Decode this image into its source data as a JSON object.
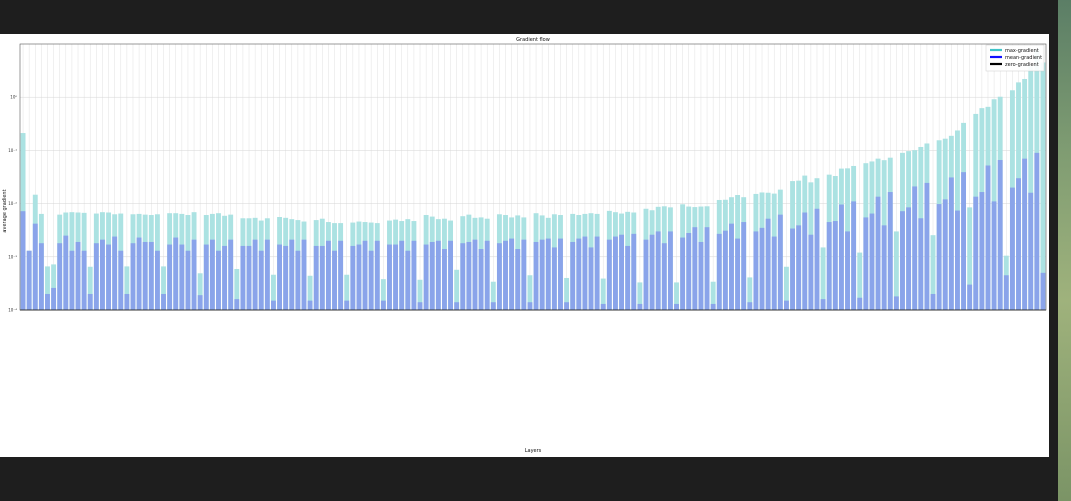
{
  "colors": {
    "max_bar": "#abe2e2",
    "mean_bar": "#8aa4ea",
    "zero_line": "#000000",
    "legend_max": "#3fc4c9",
    "legend_mean": "#1010ff",
    "grid": "#d6d6d6"
  },
  "chart_data": {
    "type": "bar",
    "title": "Gradient flow",
    "xlabel": "Layers",
    "ylabel": "average gradient",
    "y_scale": "log",
    "ylim": [
      0.0001,
      10
    ],
    "y_ticks": [
      {
        "value": 0.0001,
        "label": "10⁻⁴"
      },
      {
        "value": 0.001,
        "label": "10⁻³"
      },
      {
        "value": 0.01,
        "label": "10⁻²"
      },
      {
        "value": 0.1,
        "label": "10⁻¹"
      },
      {
        "value": 1,
        "label": "10⁰"
      }
    ],
    "grid": true,
    "legend": {
      "placement": "top-right",
      "entries": [
        "max-gradient",
        "mean-gradient",
        "zero-gradient"
      ]
    },
    "series": [
      {
        "name": "max-gradient",
        "values": [
          0.212,
          0.0013,
          0.0147,
          0.0064,
          0.00066,
          0.00072,
          0.0062,
          0.0068,
          0.0069,
          0.0068,
          0.0067,
          0.00065,
          0.0065,
          0.0069,
          0.0068,
          0.0063,
          0.0065,
          0.00066,
          0.0063,
          0.0064,
          0.0062,
          0.0061,
          0.0063,
          0.00066,
          0.0066,
          0.0066,
          0.0064,
          0.0061,
          0.0069,
          0.00049,
          0.0061,
          0.0064,
          0.0066,
          0.0059,
          0.0062,
          0.00059,
          0.0053,
          0.0053,
          0.0054,
          0.0048,
          0.0053,
          0.00046,
          0.0056,
          0.0054,
          0.0051,
          0.0049,
          0.0046,
          0.00044,
          0.0049,
          0.0052,
          0.0045,
          0.0043,
          0.0043,
          0.00046,
          0.0044,
          0.0046,
          0.0045,
          0.0044,
          0.0043,
          0.00038,
          0.0048,
          0.005,
          0.0047,
          0.0051,
          0.0047,
          0.00037,
          0.0061,
          0.0057,
          0.0051,
          0.0052,
          0.0048,
          0.00057,
          0.0058,
          0.0062,
          0.0054,
          0.0055,
          0.0052,
          0.00034,
          0.0063,
          0.0061,
          0.0055,
          0.006,
          0.0055,
          0.00045,
          0.0066,
          0.006,
          0.0054,
          0.0063,
          0.0061,
          0.0004,
          0.0064,
          0.0061,
          0.0064,
          0.0066,
          0.0064,
          0.00039,
          0.0073,
          0.0069,
          0.0065,
          0.007,
          0.0068,
          0.00033,
          0.008,
          0.0075,
          0.0087,
          0.0089,
          0.0085,
          0.00033,
          0.0097,
          0.0088,
          0.0086,
          0.0088,
          0.0089,
          0.00034,
          0.0117,
          0.0118,
          0.0132,
          0.0145,
          0.0132,
          0.00041,
          0.0152,
          0.0162,
          0.016,
          0.0154,
          0.0183,
          0.00065,
          0.0265,
          0.027,
          0.0336,
          0.0251,
          0.03,
          0.0015,
          0.035,
          0.033,
          0.0455,
          0.046,
          0.051,
          0.0012,
          0.0575,
          0.062,
          0.07,
          0.0655,
          0.073,
          0.003,
          0.09,
          0.097,
          0.101,
          0.116,
          0.135,
          0.00255,
          0.155,
          0.166,
          0.188,
          0.237,
          0.329,
          0.0085,
          0.485,
          0.623,
          0.659,
          0.915,
          1.02,
          0.00105,
          1.35,
          1.9,
          2.2,
          3.8,
          7.8,
          4.5
        ]
      },
      {
        "name": "mean-gradient",
        "values": [
          0.0072,
          0.0013,
          0.0042,
          0.0018,
          0.0002,
          0.00026,
          0.0018,
          0.0025,
          0.0013,
          0.0019,
          0.0013,
          0.0002,
          0.0018,
          0.0021,
          0.0017,
          0.0024,
          0.0013,
          0.0002,
          0.0018,
          0.0023,
          0.0019,
          0.0019,
          0.0013,
          0.0002,
          0.0017,
          0.0023,
          0.0017,
          0.0013,
          0.0021,
          0.00019,
          0.0017,
          0.0021,
          0.0013,
          0.0016,
          0.0021,
          0.00016,
          0.0016,
          0.0016,
          0.0021,
          0.0013,
          0.0021,
          0.00015,
          0.0017,
          0.0016,
          0.0021,
          0.0013,
          0.0021,
          0.00015,
          0.0016,
          0.0016,
          0.002,
          0.0013,
          0.002,
          0.00015,
          0.0016,
          0.0017,
          0.002,
          0.0013,
          0.002,
          0.00015,
          0.0017,
          0.0017,
          0.002,
          0.0013,
          0.002,
          0.00014,
          0.0017,
          0.0019,
          0.002,
          0.0014,
          0.002,
          0.00014,
          0.0018,
          0.0019,
          0.0021,
          0.0014,
          0.002,
          0.00014,
          0.0018,
          0.002,
          0.0022,
          0.0014,
          0.0021,
          0.00014,
          0.0019,
          0.0021,
          0.0022,
          0.0015,
          0.0022,
          0.00014,
          0.0019,
          0.0022,
          0.0024,
          0.0015,
          0.0024,
          0.00013,
          0.0021,
          0.0024,
          0.0026,
          0.0016,
          0.0027,
          0.00013,
          0.0021,
          0.0026,
          0.003,
          0.0018,
          0.003,
          0.00013,
          0.0023,
          0.0028,
          0.0036,
          0.0019,
          0.0036,
          0.00013,
          0.0027,
          0.0031,
          0.0042,
          0.0022,
          0.0045,
          0.00014,
          0.003,
          0.0035,
          0.0052,
          0.0024,
          0.0062,
          0.00015,
          0.0034,
          0.0039,
          0.0068,
          0.0026,
          0.008,
          0.00016,
          0.0045,
          0.0047,
          0.0096,
          0.003,
          0.011,
          0.00017,
          0.0055,
          0.0065,
          0.0135,
          0.0039,
          0.0165,
          0.00018,
          0.0072,
          0.0085,
          0.021,
          0.0053,
          0.0245,
          0.0002,
          0.0098,
          0.012,
          0.031,
          0.0074,
          0.039,
          0.0003,
          0.0135,
          0.0165,
          0.052,
          0.011,
          0.066,
          0.00045,
          0.02,
          0.03,
          0.07,
          0.016,
          0.09,
          0.0005,
          0.052,
          0.086,
          0.115,
          0.082,
          0.118,
          0.0004
        ]
      }
    ]
  }
}
